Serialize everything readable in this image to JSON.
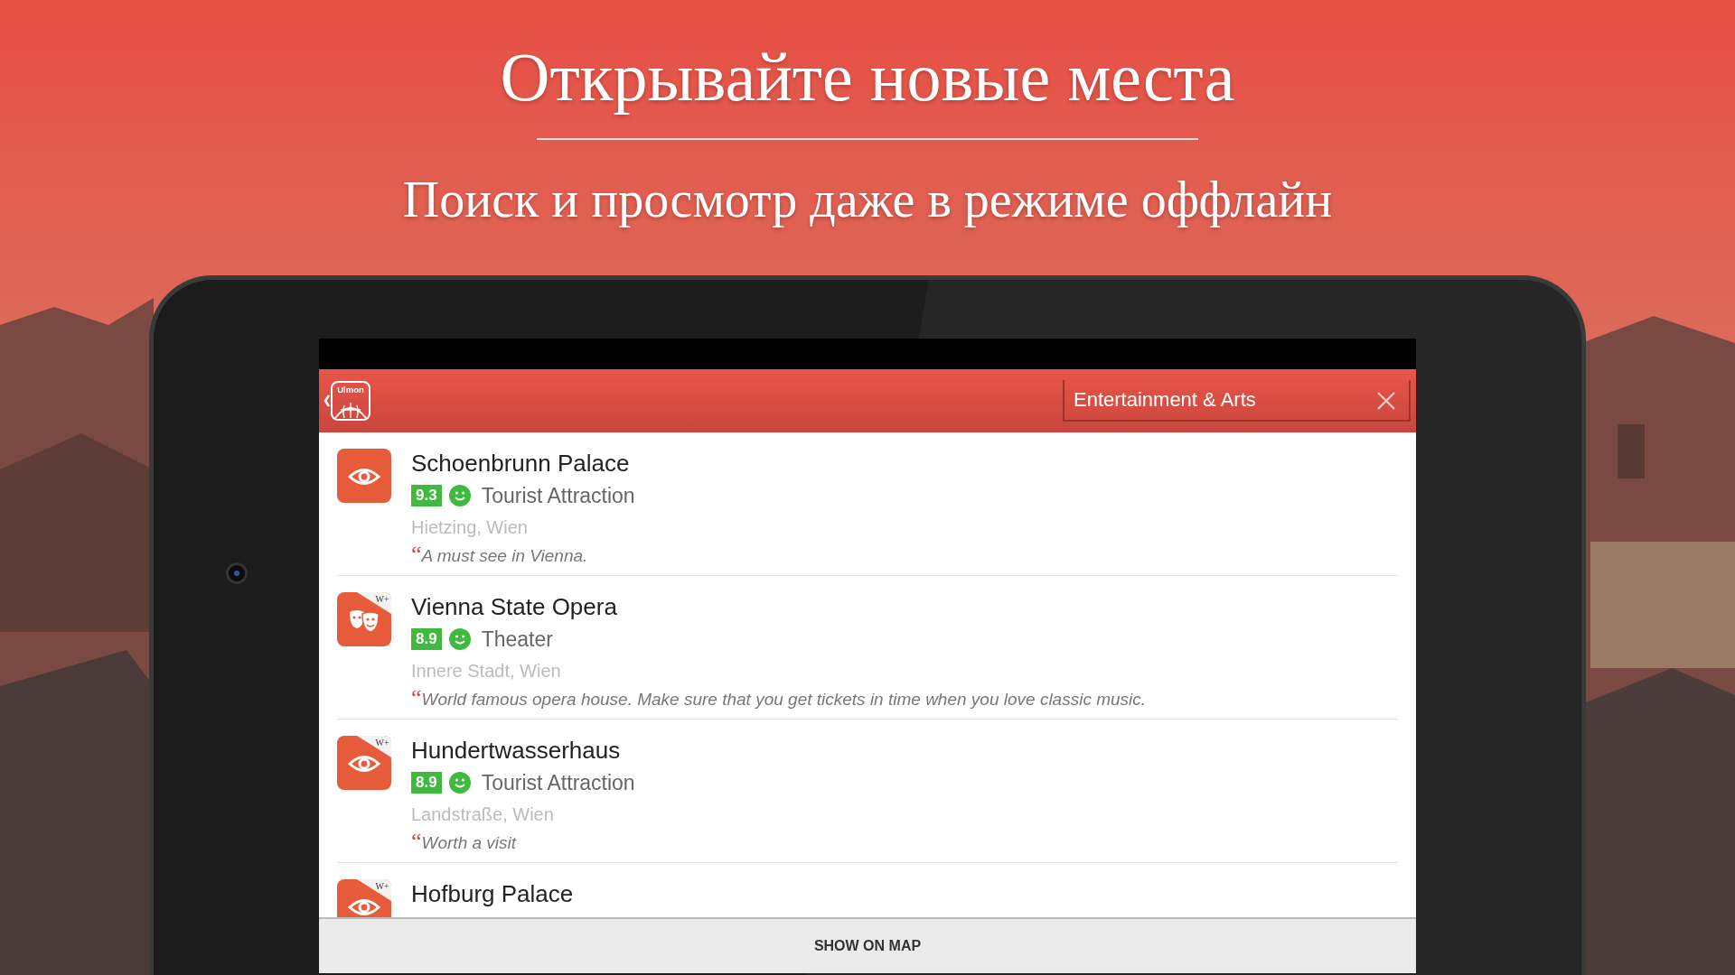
{
  "headline": "Открывайте новые места",
  "subheadline": "Поиск и просмотр даже в режиме оффлайн",
  "app_bar": {
    "logo_text": "Ulmon",
    "search": {
      "value": "Entertainment & Arts"
    }
  },
  "places": [
    {
      "kind": "eye",
      "name": "Schoenbrunn Palace",
      "rating": "9.3",
      "category": "Tourist Attraction",
      "location": "Hietzing, Wien",
      "quote_mark": "“",
      "quote": "A must see in Vienna."
    },
    {
      "kind": "masks",
      "badge": "W+",
      "name": "Vienna State Opera",
      "rating": "8.9",
      "category": "Theater",
      "location": "Innere Stadt, Wien",
      "quote_mark": "“",
      "quote": "World famous opera house. Make sure that you get tickets in time when you love classic music."
    },
    {
      "kind": "eye",
      "badge": "W+",
      "name": "Hundertwasserhaus",
      "rating": "8.9",
      "category": "Tourist Attraction",
      "location": "Landstraße, Wien",
      "quote_mark": "“",
      "quote": "Worth a visit"
    },
    {
      "kind": "eye",
      "badge": "W+",
      "name": "Hofburg Palace"
    }
  ],
  "bottom_button": "SHOW ON MAP"
}
